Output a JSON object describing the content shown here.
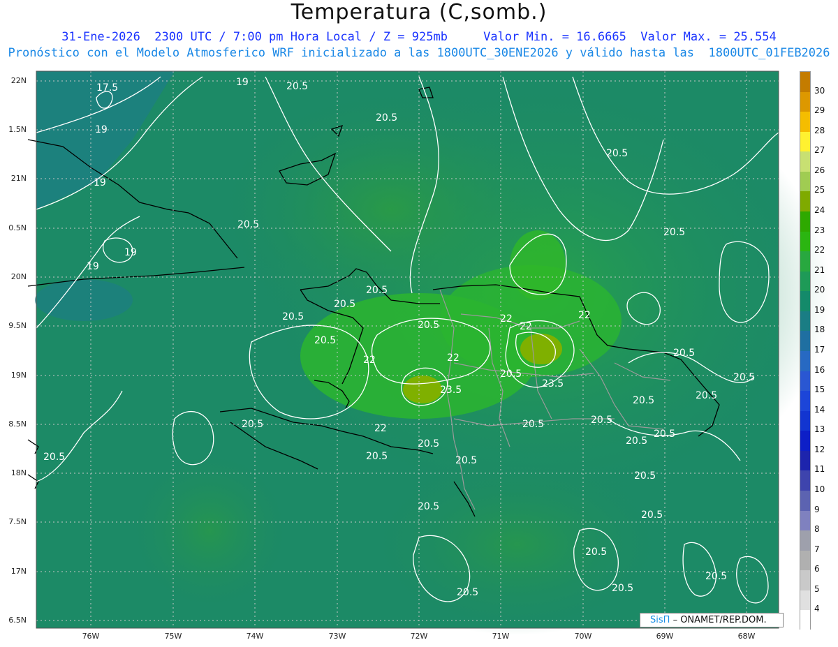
{
  "header": {
    "title": "Temperatura (C,somb.)",
    "line1": "31-Ene-2026  2300 UTC / 7:00 pm Hora Local / Z = 925mb     Valor Min. = 16.6665  Valor Max. = 25.554",
    "line2": "Pronóstico con el Modelo Atmosferico WRF inicializado a las 1800UTC_30ENE2026 y válido hasta las  1800UTC_01FEB2026"
  },
  "axes": {
    "lat_labels": [
      "22N",
      "1.5N",
      "21N",
      "0.5N",
      "20N",
      "9.5N",
      "19N",
      "8.5N",
      "18N",
      "7.5N",
      "17N",
      "6.5N"
    ],
    "lon_labels": [
      "76W",
      "75W",
      "74W",
      "73W",
      "72W",
      "71W",
      "70W",
      "69W",
      "68W"
    ]
  },
  "colorbar": {
    "labels": [
      "30",
      "29",
      "28",
      "27",
      "26",
      "25",
      "24",
      "23",
      "22",
      "21",
      "20",
      "19",
      "18",
      "17",
      "16",
      "15",
      "14",
      "13",
      "12",
      "11",
      "10",
      "9",
      "8",
      "7",
      "6",
      "5",
      "4"
    ],
    "colors": [
      "#c47c00",
      "#dd9800",
      "#f5bd00",
      "#fff130",
      "#c8e072",
      "#a0cc52",
      "#7faa00",
      "#2ea900",
      "#2bb511",
      "#28a83f",
      "#1e9a57",
      "#148a6a",
      "#1a7d84",
      "#1f6fa1",
      "#2769c2",
      "#2a57d2",
      "#1c45d8",
      "#1235d0",
      "#0d1fc7",
      "#1d24ad",
      "#3e44ad",
      "#5c63b1",
      "#7f81bf",
      "#9ea0ac",
      "#b0b0b0",
      "#c9c9c9",
      "#e0e0e0",
      "#ffffff"
    ]
  },
  "contour_labels": [
    "17.5",
    "19",
    "19",
    "19",
    "19",
    "19",
    "20.5",
    "20.5",
    "20.5",
    "20.5",
    "20.5",
    "20.5",
    "20.5",
    "20.5",
    "20.5",
    "20.5",
    "20.5",
    "20.5",
    "20.5",
    "20.5",
    "20.5",
    "20.5",
    "20.5",
    "20.5",
    "20.5",
    "20.5",
    "20.5",
    "20.5",
    "20.5",
    "20.5",
    "20.5",
    "20.5",
    "20.5",
    "20.5",
    "20.5",
    "20.5",
    "20.5",
    "22",
    "22",
    "22",
    "22",
    "22",
    "22",
    "23.5",
    "23.5"
  ],
  "credit": {
    "brand": "SisΠ",
    "org": "– ONAMET/REP.DOM."
  }
}
